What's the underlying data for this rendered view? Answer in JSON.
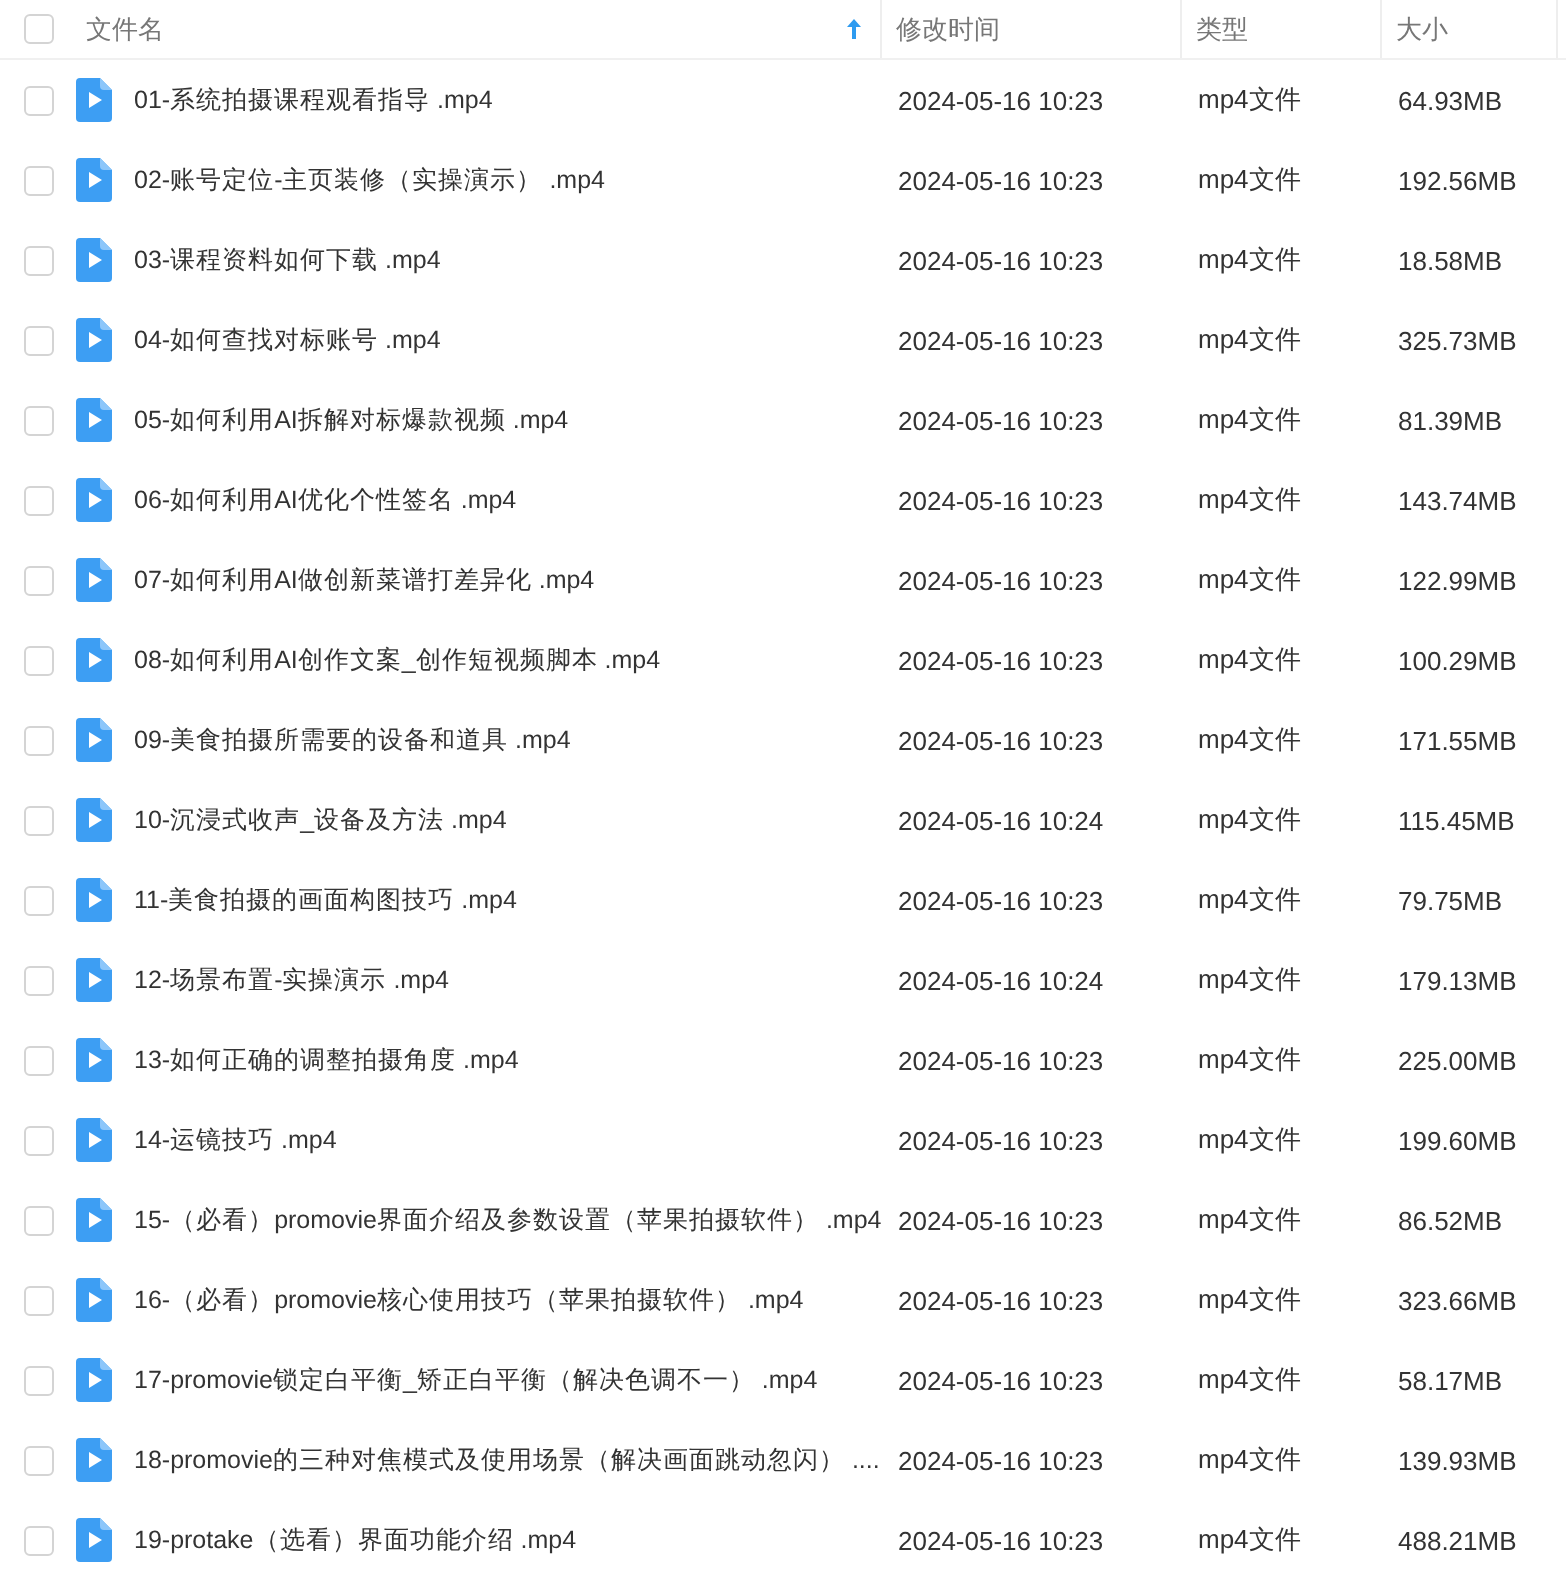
{
  "table": {
    "select_all": {
      "checked": false
    },
    "columns": [
      {
        "label": "文件名",
        "sorted": true
      },
      {
        "label": "修改时间",
        "sorted": false
      },
      {
        "label": "类型",
        "sorted": false
      },
      {
        "label": "大小",
        "sorted": false
      }
    ],
    "rows": [
      {
        "checked": false,
        "name": "01-系统拍摄课程观看指导 .mp4",
        "modified": "2024-05-16 10:23",
        "type": "mp4文件",
        "size": "64.93MB"
      },
      {
        "checked": false,
        "name": "02-账号定位-主页装修（实操演示） .mp4",
        "modified": "2024-05-16 10:23",
        "type": "mp4文件",
        "size": "192.56MB"
      },
      {
        "checked": false,
        "name": "03-课程资料如何下载 .mp4",
        "modified": "2024-05-16 10:23",
        "type": "mp4文件",
        "size": "18.58MB"
      },
      {
        "checked": false,
        "name": "04-如何查找对标账号 .mp4",
        "modified": "2024-05-16 10:23",
        "type": "mp4文件",
        "size": "325.73MB"
      },
      {
        "checked": false,
        "name": "05-如何利用AI拆解对标爆款视频 .mp4",
        "modified": "2024-05-16 10:23",
        "type": "mp4文件",
        "size": "81.39MB"
      },
      {
        "checked": false,
        "name": "06-如何利用AI优化个性签名 .mp4",
        "modified": "2024-05-16 10:23",
        "type": "mp4文件",
        "size": "143.74MB"
      },
      {
        "checked": false,
        "name": "07-如何利用AI做创新菜谱打差异化 .mp4",
        "modified": "2024-05-16 10:23",
        "type": "mp4文件",
        "size": "122.99MB"
      },
      {
        "checked": false,
        "name": "08-如何利用AI创作文案_创作短视频脚本 .mp4",
        "modified": "2024-05-16 10:23",
        "type": "mp4文件",
        "size": "100.29MB"
      },
      {
        "checked": false,
        "name": "09-美食拍摄所需要的设备和道具 .mp4",
        "modified": "2024-05-16 10:23",
        "type": "mp4文件",
        "size": "171.55MB"
      },
      {
        "checked": false,
        "name": "10-沉浸式收声_设备及方法 .mp4",
        "modified": "2024-05-16 10:24",
        "type": "mp4文件",
        "size": "115.45MB"
      },
      {
        "checked": false,
        "name": "11-美食拍摄的画面构图技巧 .mp4",
        "modified": "2024-05-16 10:23",
        "type": "mp4文件",
        "size": "79.75MB"
      },
      {
        "checked": false,
        "name": "12-场景布置-实操演示 .mp4",
        "modified": "2024-05-16 10:24",
        "type": "mp4文件",
        "size": "179.13MB"
      },
      {
        "checked": false,
        "name": "13-如何正确的调整拍摄角度 .mp4",
        "modified": "2024-05-16 10:23",
        "type": "mp4文件",
        "size": "225.00MB"
      },
      {
        "checked": false,
        "name": "14-运镜技巧 .mp4",
        "modified": "2024-05-16 10:23",
        "type": "mp4文件",
        "size": "199.60MB"
      },
      {
        "checked": false,
        "name": "15-（必看）promovie界面介绍及参数设置（苹果拍摄软件） .mp4",
        "modified": "2024-05-16 10:23",
        "type": "mp4文件",
        "size": "86.52MB"
      },
      {
        "checked": false,
        "name": "16-（必看）promovie核心使用技巧（苹果拍摄软件） .mp4",
        "modified": "2024-05-16 10:23",
        "type": "mp4文件",
        "size": "323.66MB"
      },
      {
        "checked": false,
        "name": "17-promovie锁定白平衡_矫正白平衡（解决色调不一） .mp4",
        "modified": "2024-05-16 10:23",
        "type": "mp4文件",
        "size": "58.17MB"
      },
      {
        "checked": false,
        "name": "18-promovie的三种对焦模式及使用场景（解决画面跳动忽闪） ....",
        "modified": "2024-05-16 10:23",
        "type": "mp4文件",
        "size": "139.93MB"
      },
      {
        "checked": false,
        "name": "19-protake（选看）界面功能介绍 .mp4",
        "modified": "2024-05-16 10:23",
        "type": "mp4文件",
        "size": "488.21MB"
      }
    ]
  }
}
